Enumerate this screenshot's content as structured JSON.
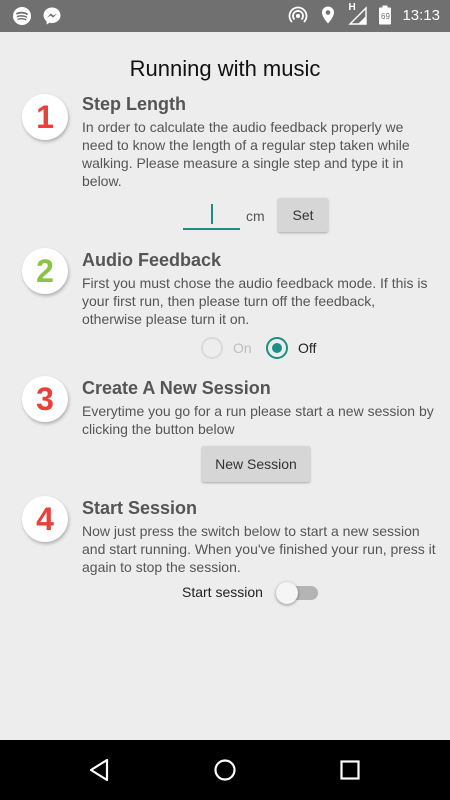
{
  "status_bar": {
    "time": "13:13",
    "left_icons": [
      "spotify-icon",
      "messenger-icon"
    ],
    "right_icons": [
      "hotspot-icon",
      "location-icon",
      "signal-icon",
      "battery-icon"
    ],
    "signal_label": "H",
    "battery_level": "69"
  },
  "app": {
    "title": "Running with music"
  },
  "steps": [
    {
      "number": "1",
      "title": "Step Length",
      "description": "In order to calculate the audio feedback properly we need to know the length of a regular step taken while walking. Please measure a single step and type it in below.",
      "input_value": "",
      "unit": "cm",
      "button_label": "Set"
    },
    {
      "number": "2",
      "title": "Audio Feedback",
      "description": "First you must chose the audio feedback mode. If this is your first run, then please turn off the feedback, otherwise please turn it on.",
      "options": [
        {
          "label": "On",
          "selected": false,
          "enabled": false
        },
        {
          "label": "Off",
          "selected": true,
          "enabled": true
        }
      ]
    },
    {
      "number": "3",
      "title": "Create A New Session",
      "description": "Everytime you go for a run please start a new session by clicking the button below",
      "button_label": "New Session"
    },
    {
      "number": "4",
      "title": "Start Session",
      "description": "Now just press the switch below to start a new session and start running. When you've finished your run, press it again to stop the session.",
      "switch_label": "Start session",
      "switch_on": false
    }
  ],
  "nav_bar": {
    "buttons": [
      "back-icon",
      "home-icon",
      "recents-icon"
    ]
  },
  "colors": {
    "accent": "#1b8f83",
    "red_badge": "#e8413a",
    "green_badge": "#8bc34a",
    "background": "#ededed",
    "status_bar": "#707070"
  }
}
